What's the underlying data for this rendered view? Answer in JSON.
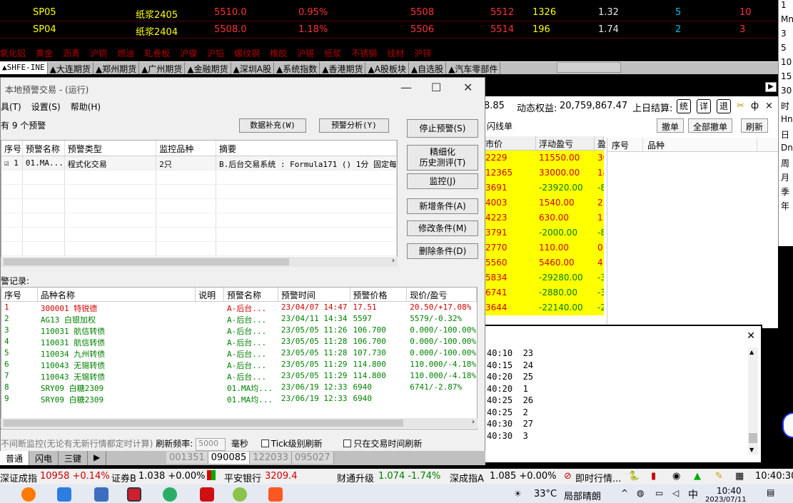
{
  "quotes": [
    {
      "name": "SP05",
      "cn": "纸浆2405",
      "last": "5510.0",
      "change": "0.95%",
      "bid": "5508",
      "ask": "5512",
      "vol": "1326",
      "ratio": "1.32",
      "bidvol": "5",
      "askvol": "10"
    },
    {
      "name": "SP04",
      "cn": "纸浆2404",
      "last": "5508.0",
      "change": "1.18%",
      "bid": "5506",
      "ask": "5514",
      "vol": "196",
      "ratio": "1.74",
      "bidvol": "2",
      "askvol": "3"
    }
  ],
  "category_strip": [
    "氧化铝",
    "黄金",
    "沥青",
    "沪铜",
    "燃油",
    "轧卷板",
    "沪镍",
    "沪铅",
    "螺纹钢",
    "橡胶",
    "沪锡",
    "纸浆",
    "不锈钢",
    "线材",
    "沪锌"
  ],
  "market_tabs": [
    "▲SHFE-INE",
    "▲大连期货",
    "▲郑州期货",
    "▲广州期货",
    "▲金融期货",
    "▲深圳A股",
    "▲系统指数",
    "▲香港期货",
    "▲A股板块",
    "▲自选股",
    "▲汽车零部件"
  ],
  "right_col": [
    "1",
    "Mn",
    "3",
    "5",
    "10",
    "15",
    "30",
    "时",
    "Hn",
    "日",
    "Dn",
    "周",
    "月",
    "季",
    "年"
  ],
  "trade": {
    "balance_tail": "8.85",
    "equity_label": "动态权益:",
    "equity": "20,759,867.47",
    "settle_label": "上日结算:",
    "btn_tong": "统",
    "btn_xiang": "详",
    "btn_tui": "退",
    "tab_label": "闪线单",
    "cancel": "撤单",
    "cancel_all": "全部撤单",
    "refresh": "刷新",
    "col_price": "市价",
    "col_pnl": "浮动盈亏",
    "col_more": "盈",
    "rows": [
      {
        "price": "2229",
        "pnl": "11550.00",
        "more": "30"
      },
      {
        "price": "12365",
        "pnl": "33000.00",
        "more": "14"
      },
      {
        "price": "3691",
        "pnl": "-23920.00",
        "more": "-8"
      },
      {
        "price": "4003",
        "pnl": "1540.00",
        "more": "2."
      },
      {
        "price": "4223",
        "pnl": "630.00",
        "more": "1."
      },
      {
        "price": "3791",
        "pnl": "-2000.00",
        "more": "-8"
      },
      {
        "price": "2770",
        "pnl": "110.00",
        "more": "0."
      },
      {
        "price": "5560",
        "pnl": "5460.00",
        "more": "4."
      },
      {
        "price": "5834",
        "pnl": "-29280.00",
        "more": "-3"
      },
      {
        "price": "6741",
        "pnl": "-2880.00",
        "more": "-3"
      },
      {
        "price": "3644",
        "pnl": "-22140.00",
        "more": "-2"
      }
    ],
    "order_cols": [
      "序号",
      "品种"
    ]
  },
  "log": {
    "lines": [
      "40:10  23",
      "40:15  24",
      "40:20  25",
      "40:20  1",
      "40:25  26",
      "40:25  2",
      "40:30  27",
      "40:30  3"
    ]
  },
  "dialog": {
    "title": "本地预警交易 - (运行)",
    "menus": [
      "具(T)",
      "设置(S)",
      "帮助(H)"
    ],
    "count": "有 9 个预警",
    "btn_fill": "数据补充(W)",
    "btn_analyze": "预警分析(Y)",
    "btn_stop": "停止预警(S)",
    "btn_fine_1": "精细化",
    "btn_fine_2": "历史测评(T)",
    "btn_monitor": "监控(J)",
    "btn_add": "新增条件(A)",
    "btn_edit": "修改条件(M)",
    "btn_delete": "删除条件(D)",
    "warn_headers": [
      "序号",
      "预警名称",
      "预警类型",
      "监控品种",
      "摘要"
    ],
    "warn_rows": [
      {
        "no": "☑ 1",
        "name": "01.MA...",
        "type": "程式化交易",
        "items": "2只",
        "summary": "B.后台交易系统 : Formula171 () 1分 固定每"
      }
    ],
    "rec_label": "警记录:",
    "rec_headers": [
      "序号",
      "品种名称",
      "说明",
      "预警名称",
      "预警时间",
      "预警价格",
      "现价/盈亏"
    ],
    "rec_rows": [
      {
        "no": "1",
        "name": "300001 特锐德",
        "desc": "",
        "warn": "A-后台...",
        "time": "23/04/07 14:47",
        "price": "17.51",
        "now": "20.50/+17.08%",
        "color": "#d00000"
      },
      {
        "no": "2",
        "name": "AG13 白银加权",
        "desc": "",
        "warn": "A-后台...",
        "time": "23/04/11 14:34",
        "price": "5597",
        "now": "5579/-0.32%",
        "color": "#008000"
      },
      {
        "no": "3",
        "name": "110031 航信转债",
        "desc": "",
        "warn": "A-后台...",
        "time": "23/05/05 11:26",
        "price": "106.700",
        "now": "0.000/-100.00%",
        "color": "#008000"
      },
      {
        "no": "4",
        "name": "110031 航信转债",
        "desc": "",
        "warn": "A-后台...",
        "time": "23/05/05 11:28",
        "price": "106.700",
        "now": "0.000/-100.00%",
        "color": "#008000"
      },
      {
        "no": "5",
        "name": "110034 九州转债",
        "desc": "",
        "warn": "A-后台...",
        "time": "23/05/05 11:28",
        "price": "107.730",
        "now": "0.000/-100.00%",
        "color": "#008000"
      },
      {
        "no": "6",
        "name": "110043 无锡转债",
        "desc": "",
        "warn": "A-后台...",
        "time": "23/05/05 11:29",
        "price": "114.800",
        "now": "110.000/-4.18%",
        "color": "#008000"
      },
      {
        "no": "7",
        "name": "110043 无锡转债",
        "desc": "",
        "warn": "A-后台...",
        "time": "23/05/05 11:29",
        "price": "114.800",
        "now": "110.000/-4.18%",
        "color": "#008000"
      },
      {
        "no": "8",
        "name": "SRY09 白糖2309",
        "desc": "",
        "warn": "01.MA均...",
        "time": "23/06/19 12:33",
        "price": "6940",
        "now": "6741/-2.87%",
        "color": "#008000"
      },
      {
        "no": "9",
        "name": "SRY09 白糖2309",
        "desc": "",
        "warn": "01.MA均...",
        "time": "23/06/19 12:33",
        "price": "6940",
        "now": "",
        "color": "#008000"
      }
    ],
    "opt_monitor": "不间断监控(无论有无新行情都定时计算)",
    "opt_freq_label": "刷新频率:",
    "opt_freq_placeholder": "5000",
    "opt_unit": "毫秒",
    "opt_tick": "Tick级别刷新",
    "opt_trade_time": "只在交易时间刷新"
  },
  "bottom_tabs": [
    "普通",
    "闪电",
    "三键",
    "▶"
  ],
  "bottom_codes": [
    "001351",
    "090085",
    "122033",
    "095027"
  ],
  "status": {
    "s1_name": "深证成指",
    "s1_val": "10958 +0.14%",
    "s2_name": "证券B",
    "s2_val": "1.038 +0.00%",
    "s3_name": "平安银行",
    "s3_val": "3209.4",
    "s4_name": "财通升级",
    "s4_val": "1.074 -1.74%",
    "s5_name": "深成指A",
    "s5_val": "1.085 +0.00%",
    "s6": "即时行情...",
    "clock": "10:40:30"
  },
  "taskbar": {
    "temp": "33°C",
    "weather": "局部晴朗",
    "ime": "中",
    "time": "10:40",
    "date": "2023/07/11"
  }
}
